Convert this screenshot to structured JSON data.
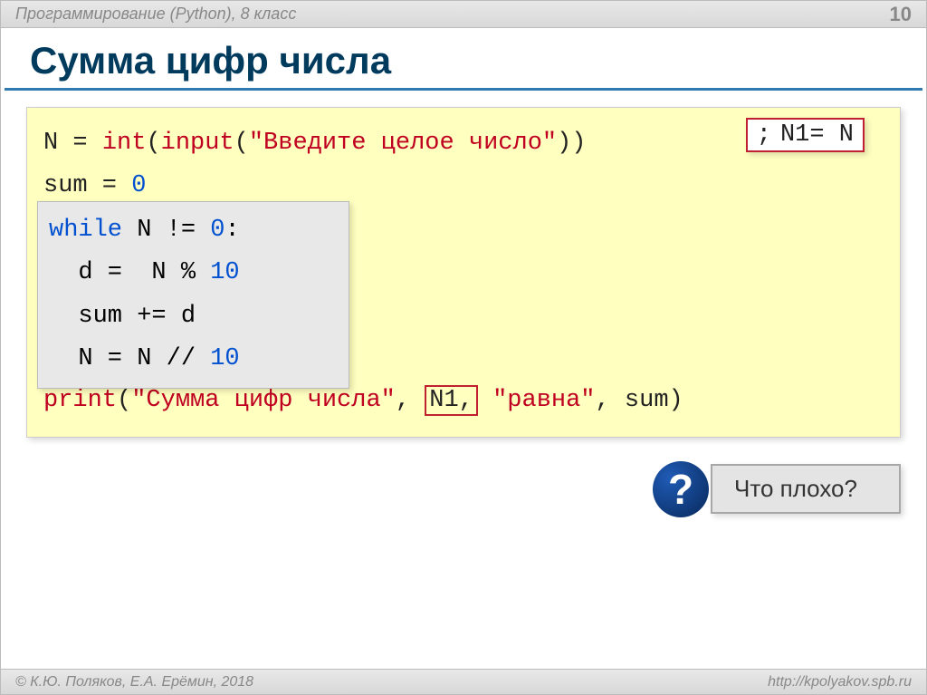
{
  "header": {
    "subject": "Программирование (Python), 8 класс",
    "page": "10"
  },
  "title": "Сумма цифр числа",
  "code": {
    "line1_a": "N = ",
    "line1_int": "int",
    "line1_b": "(",
    "line1_input": "input",
    "line1_c": "(",
    "line1_str": "\"Введите целое число\"",
    "line1_d": "))",
    "overlay_semi": ";",
    "overlay_text": "N1= N",
    "line2_a": "sum = ",
    "line2_zero": "0",
    "inner1_kw": "while",
    "inner1_rest": " N != ",
    "inner1_zero": "0",
    "inner1_colon": ":",
    "inner2_a": "  d =  N % ",
    "inner2_ten": "10",
    "inner3": "  sum += d",
    "inner4_a": "  N = N // ",
    "inner4_ten": "10",
    "print_kw": "print",
    "print_a": "(",
    "print_str1": "\"Сумма цифр числа\"",
    "print_b": ", ",
    "print_boxed": "N1,",
    "print_c": " ",
    "print_str2": "\"равна\"",
    "print_d": ", sum)"
  },
  "question": {
    "mark": "?",
    "text": "Что плохо?"
  },
  "footer": {
    "left": "© К.Ю. Поляков, Е.А. Ерёмин, 2018",
    "right": "http://kpolyakov.spb.ru"
  }
}
